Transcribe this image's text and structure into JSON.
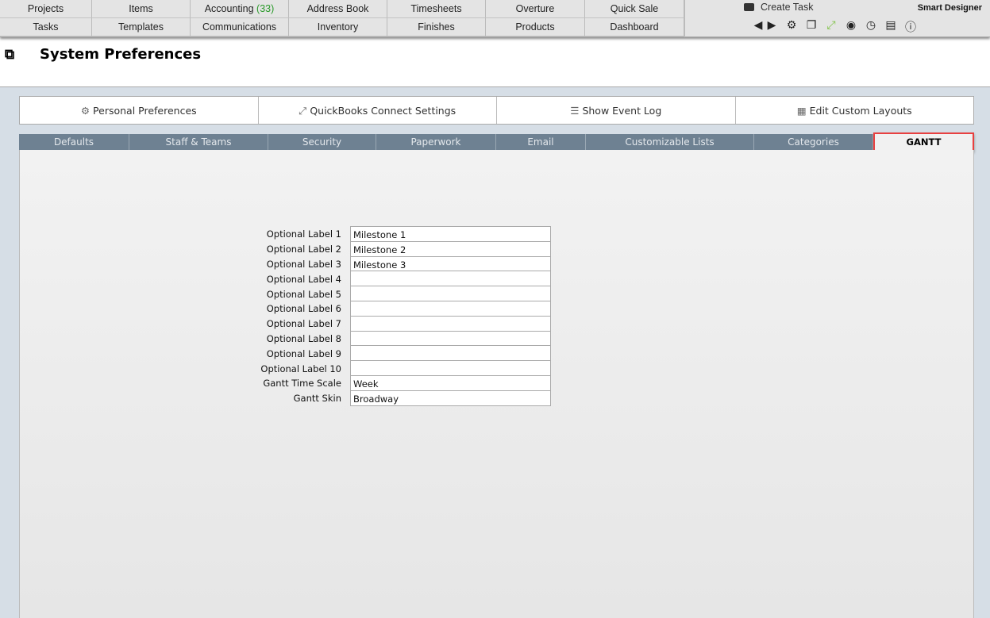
{
  "nav": {
    "row1": [
      "Projects",
      "Items",
      "Accounting",
      "Address Book",
      "Timesheets",
      "Overture",
      "Quick Sale"
    ],
    "accounting_count": "(33)",
    "row2": [
      "Tasks",
      "Templates",
      "Communications",
      "Inventory",
      "Finishes",
      "Products",
      "Dashboard"
    ]
  },
  "top_right": {
    "create_task": "Create Task",
    "user": "Smart Designer",
    "icons": [
      "arrow-left-icon",
      "arrow-right-icon",
      "gear-icon",
      "windows-icon",
      "expand-icon",
      "user-icon",
      "clock-icon",
      "news-icon",
      "info-icon"
    ],
    "expand_color": "#7dc242"
  },
  "page": {
    "title": "System Preferences"
  },
  "buttons": [
    {
      "label": "Personal Preferences",
      "icon": "gear-icon"
    },
    {
      "label": "QuickBooks Connect Settings",
      "icon": "expand-icon"
    },
    {
      "label": "Show Event Log",
      "icon": "list-icon"
    },
    {
      "label": "Edit Custom Layouts",
      "icon": "table-icon"
    }
  ],
  "tabs": [
    "Defaults",
    "Staff & Teams",
    "Security",
    "Paperwork",
    "Email",
    "Customizable Lists",
    "Categories",
    "GANTT"
  ],
  "active_tab": "GANTT",
  "form": [
    {
      "label": "Optional Label 1",
      "value": "Milestone 1"
    },
    {
      "label": "Optional Label 2",
      "value": "Milestone 2"
    },
    {
      "label": "Optional Label 3",
      "value": "Milestone 3"
    },
    {
      "label": "Optional Label 4",
      "value": ""
    },
    {
      "label": "Optional Label 5",
      "value": ""
    },
    {
      "label": "Optional Label 6",
      "value": ""
    },
    {
      "label": "Optional Label 7",
      "value": ""
    },
    {
      "label": "Optional Label 8",
      "value": ""
    },
    {
      "label": "Optional Label 9",
      "value": ""
    },
    {
      "label": "Optional Label 10",
      "value": ""
    },
    {
      "label": "Gantt Time Scale",
      "value": "Week"
    },
    {
      "label": "Gantt Skin",
      "value": "Broadway"
    }
  ]
}
